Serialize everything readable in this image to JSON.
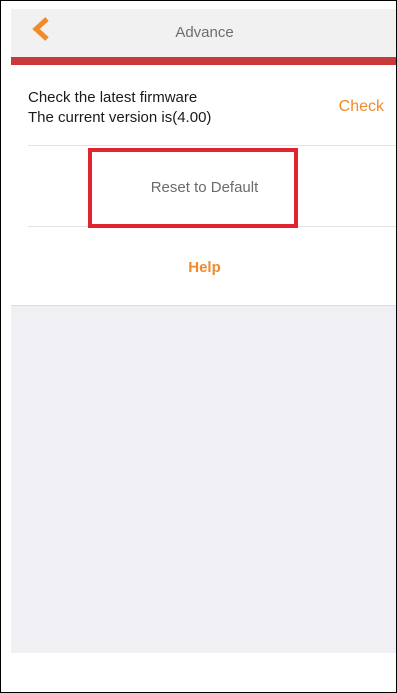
{
  "nav": {
    "title": "Advance",
    "back_icon": "chevron-left-icon",
    "accent_color": "#f08a2b",
    "bar_color": "#c9383a"
  },
  "firmware": {
    "line1": "Check the latest firmware",
    "line2": "The current version is(4.00)",
    "check_label": "Check"
  },
  "actions": {
    "reset_label": "Reset to Default",
    "help_label": "Help"
  },
  "annotation": {
    "highlight_color": "#e1252f"
  }
}
